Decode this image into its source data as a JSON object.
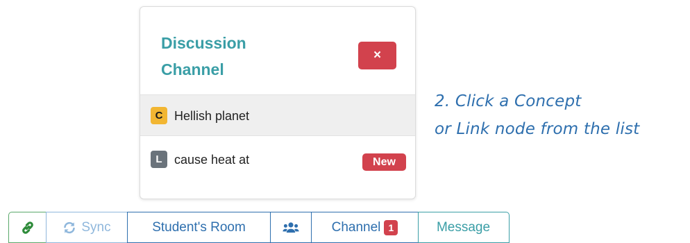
{
  "popover": {
    "title_line1": "Discussion",
    "title_line2": "Channel",
    "close_label": "×",
    "items": [
      {
        "type_badge": "C",
        "label": "Hellish planet",
        "selected": true
      },
      {
        "type_badge": "L",
        "label": "cause heat at",
        "tag": "New"
      }
    ]
  },
  "instruction": {
    "line1": "2. Click a Concept",
    "line2": "or Link node from the list"
  },
  "toolbar": {
    "link_icon": "link-icon",
    "sync_icon": "sync-icon",
    "sync_label": "Sync",
    "room_label": "Student's Room",
    "users_icon": "users-icon",
    "channel_label": "Channel",
    "channel_count": "1",
    "message_label": "Message"
  },
  "colors": {
    "teal": "#3a9ea6",
    "blue": "#2e6fae",
    "red": "#d2424d",
    "concept_yellow": "#f2b632",
    "link_gray": "#6a737b",
    "green": "#2e8b3a"
  }
}
